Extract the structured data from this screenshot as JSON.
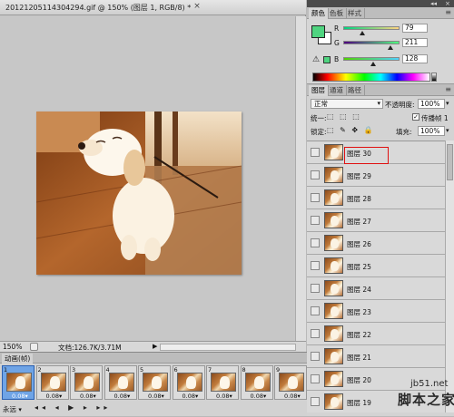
{
  "document": {
    "tab_title": "20121205114304294.gif @ 150% (图层 1, RGB/8) *",
    "close_icon": "×",
    "zoom": "150%",
    "doc_info": "文档:126.7K/3.71M",
    "status_arrow": "▶"
  },
  "dockbar": {
    "collapse": "◂◂",
    "close": "×"
  },
  "color_panel": {
    "tabs": [
      "颜色",
      "色板",
      "样式"
    ],
    "menu_icon": "≡",
    "channels": [
      {
        "label": "R",
        "value": "79"
      },
      {
        "label": "G",
        "value": "211"
      },
      {
        "label": "B",
        "value": "128"
      }
    ],
    "colors": {
      "foreground": "#4fd480",
      "background": "#ffffff"
    }
  },
  "layers_panel": {
    "tabs": [
      "图层",
      "通道",
      "路径"
    ],
    "menu_icon": "≡",
    "blend_mode": "正常",
    "opacity_label": "不透明度:",
    "opacity_value": "100%",
    "unify_label": "统一:",
    "unify_icons": "⬚ ⬚ ⬚",
    "propagate_label": "传播帧 1",
    "propagate_check": "✓",
    "lock_label": "锁定:",
    "lock_icons": "⬚ ✎ ✥ 🔒",
    "fill_label": "填充:",
    "fill_value": "100%",
    "dropdown_icon": "▾",
    "layers": [
      {
        "name": "图层 30"
      },
      {
        "name": "图层 29"
      },
      {
        "name": "图层 28"
      },
      {
        "name": "图层 27"
      },
      {
        "name": "图层 26"
      },
      {
        "name": "图层 25"
      },
      {
        "name": "图层 24"
      },
      {
        "name": "图层 23"
      },
      {
        "name": "图层 22"
      },
      {
        "name": "图层 21"
      },
      {
        "name": "图层 20"
      },
      {
        "name": "图层 19"
      }
    ]
  },
  "animation_panel": {
    "tab_title": "动画(帧)",
    "frames": [
      {
        "num": "1",
        "delay": "0.08▾"
      },
      {
        "num": "2",
        "delay": "0.08▾"
      },
      {
        "num": "3",
        "delay": "0.08▾"
      },
      {
        "num": "4",
        "delay": "0.08▾"
      },
      {
        "num": "5",
        "delay": "0.08▾"
      },
      {
        "num": "6",
        "delay": "0.08▾"
      },
      {
        "num": "7",
        "delay": "0.08▾"
      },
      {
        "num": "8",
        "delay": "0.08▾"
      },
      {
        "num": "9",
        "delay": "0.08▾"
      }
    ],
    "loop": "永远",
    "loop_dd": "▾",
    "controls": "◂◂ ◂ ▶ ▸ ▸▸"
  },
  "watermark": {
    "line1": "jb51.net",
    "line2": "脚本之家"
  }
}
